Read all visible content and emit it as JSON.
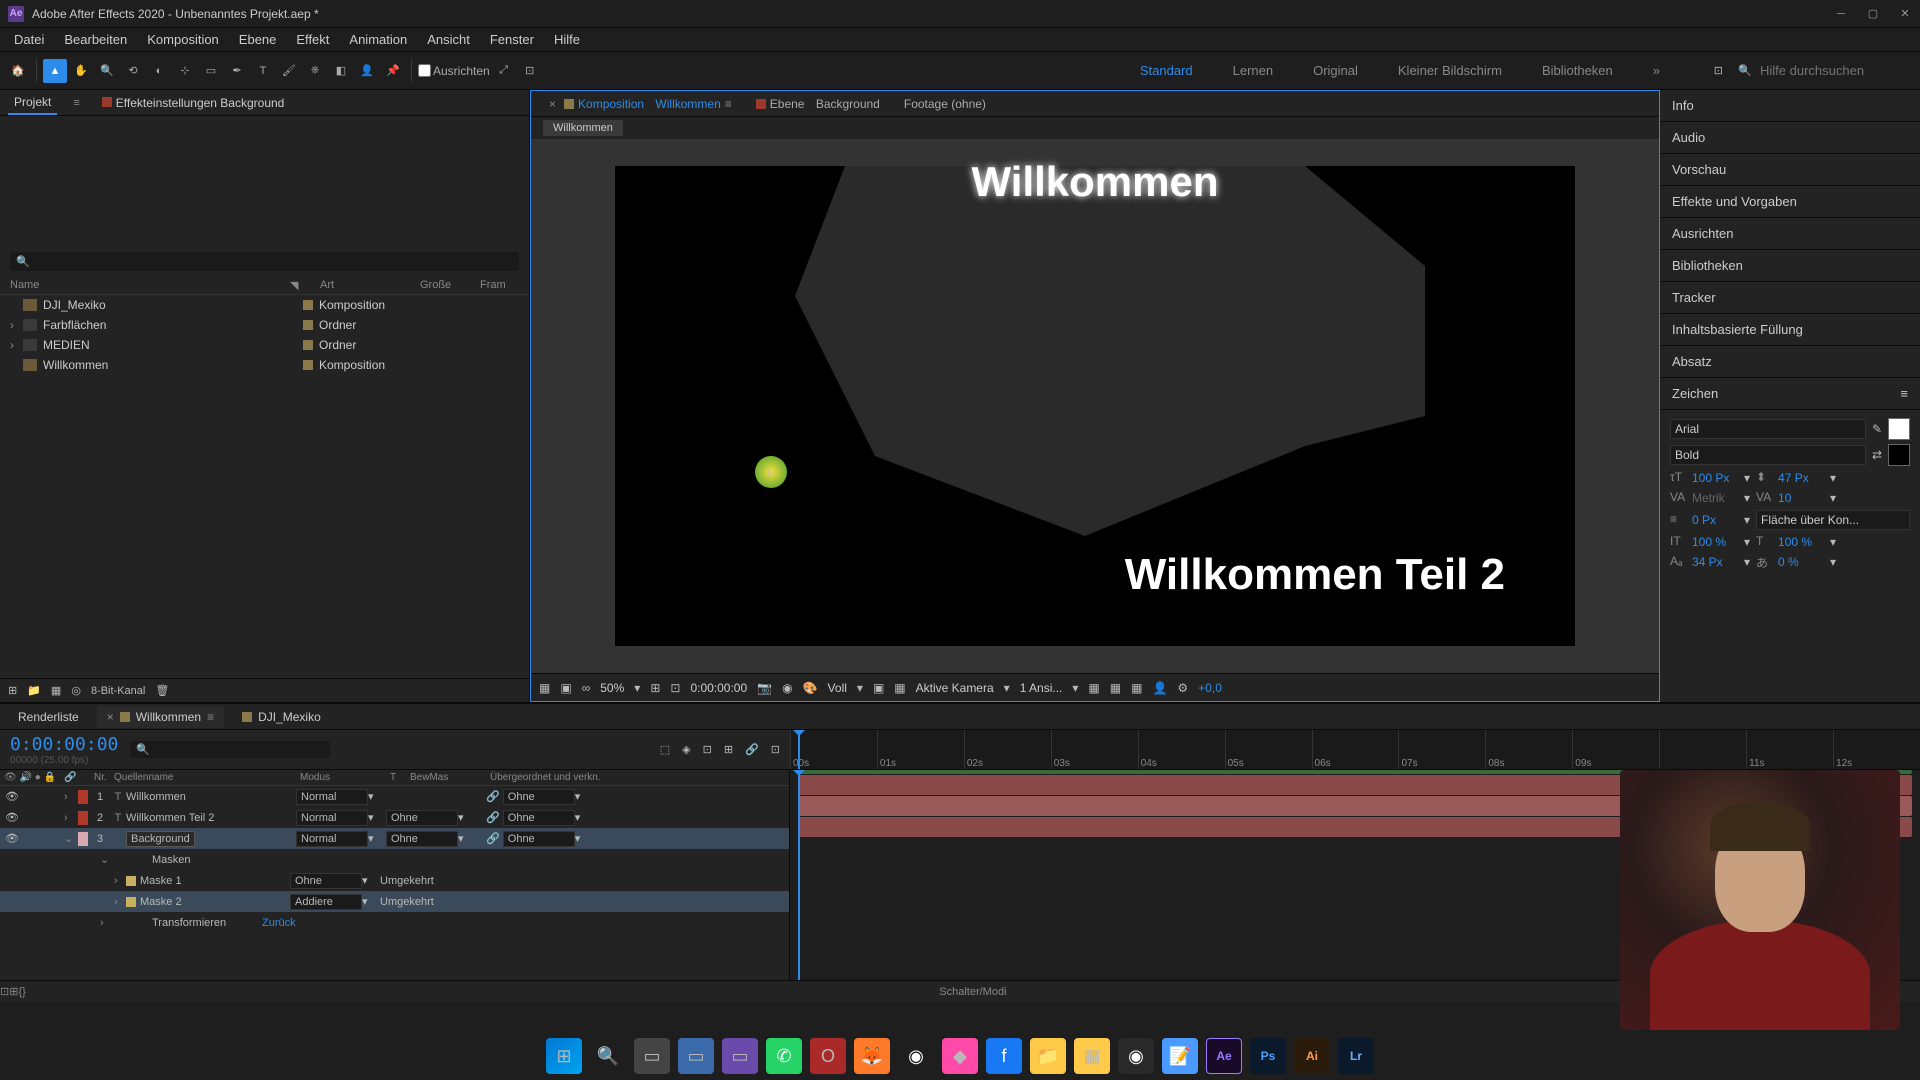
{
  "app": {
    "title": "Adobe After Effects 2020 - Unbenanntes Projekt.aep *",
    "logo": "Ae"
  },
  "menu": [
    "Datei",
    "Bearbeiten",
    "Komposition",
    "Ebene",
    "Effekt",
    "Animation",
    "Ansicht",
    "Fenster",
    "Hilfe"
  ],
  "toolbar": {
    "align": "Ausrichten",
    "search_placeholder": "Hilfe durchsuchen"
  },
  "workspaces": [
    "Standard",
    "Lernen",
    "Original",
    "Kleiner Bildschirm",
    "Bibliotheken"
  ],
  "project": {
    "tab_project": "Projekt",
    "tab_effects": "Effekteinstellungen Background",
    "cols": {
      "name": "Name",
      "art": "Art",
      "size": "Große",
      "frame": "Fram"
    },
    "items": [
      {
        "name": "DJI_Mexiko",
        "art": "Komposition",
        "type": "comp"
      },
      {
        "name": "Farbflächen",
        "art": "Ordner",
        "type": "folder",
        "chev": true
      },
      {
        "name": "MEDIEN",
        "art": "Ordner",
        "type": "folder",
        "chev": true
      },
      {
        "name": "Willkommen",
        "art": "Komposition",
        "type": "comp"
      }
    ],
    "footer_bit": "8-Bit-Kanal"
  },
  "comp": {
    "tab_komposition": "Komposition",
    "tab_komposition_name": "Willkommen",
    "tab_ebene": "Ebene",
    "tab_ebene_name": "Background",
    "tab_footage": "Footage (ohne)",
    "breadcrumb": "Willkommen",
    "text1": "Willkommen",
    "text2": "Willkommen Teil 2",
    "footer": {
      "zoom": "50%",
      "time": "0:00:00:00",
      "res": "Voll",
      "camera": "Aktive Kamera",
      "views": "1 Ansi...",
      "exp": "+0,0"
    }
  },
  "right_panels": [
    "Info",
    "Audio",
    "Vorschau",
    "Effekte und Vorgaben",
    "Ausrichten",
    "Bibliotheken",
    "Tracker",
    "Inhaltsbasierte Füllung",
    "Absatz"
  ],
  "char": {
    "title": "Zeichen",
    "font": "Arial",
    "weight": "Bold",
    "size": "100 Px",
    "leading": "47 Px",
    "kerning": "Metrik",
    "tracking": "10",
    "stroke": "0 Px",
    "stroke_opt": "Fläche über Kon...",
    "scale_v": "100 %",
    "scale_h": "100 %",
    "baseline": "34 Px",
    "tsume": "0 %"
  },
  "timeline": {
    "tab_render": "Renderliste",
    "tab_comp1": "Willkommen",
    "tab_comp2": "DJI_Mexiko",
    "timecode": "0:00:00:00",
    "timesub": "00000 (25.00 fps)",
    "cols": {
      "nr": "Nr.",
      "source": "Quellenname",
      "mode": "Modus",
      "t": "T",
      "trkmat": "BewMas",
      "parent": "Übergeordnet und verkn."
    },
    "layers": [
      {
        "nr": "1",
        "type": "T",
        "name": "Willkommen",
        "mode": "Normal",
        "trk": "",
        "parent": "Ohne",
        "color": "red"
      },
      {
        "nr": "2",
        "type": "T",
        "name": "Willkommen Teil 2",
        "mode": "Normal",
        "trk": "Ohne",
        "parent": "Ohne",
        "color": "red"
      },
      {
        "nr": "3",
        "type": "",
        "name": "Background",
        "mode": "Normal",
        "trk": "Ohne",
        "parent": "Ohne",
        "color": "pink",
        "selected": true
      }
    ],
    "masks_label": "Masken",
    "masks": [
      {
        "name": "Maske 1",
        "mode": "Ohne",
        "inv": "Umgekehrt"
      },
      {
        "name": "Maske 2",
        "mode": "Addiere",
        "inv": "Umgekehrt",
        "selected": true
      }
    ],
    "transform": "Transformieren",
    "transform_reset": "Zurück",
    "ticks": [
      "00s",
      "01s",
      "02s",
      "03s",
      "04s",
      "05s",
      "06s",
      "07s",
      "08s",
      "09s",
      "",
      "11s",
      "12s"
    ],
    "footer": "Schalter/Modi"
  }
}
